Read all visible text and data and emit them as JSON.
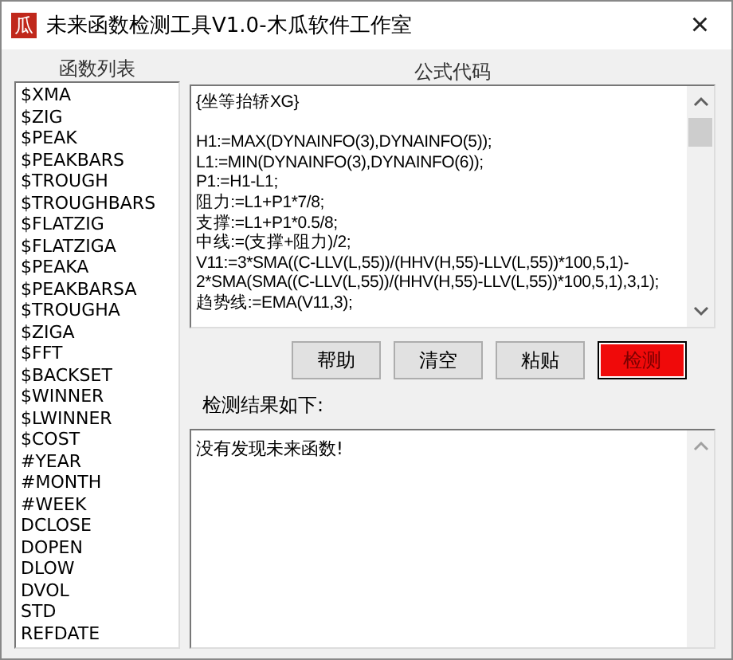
{
  "window": {
    "title": "未来函数检测工具V1.0-木瓜软件工作室",
    "icon_text": "瓜",
    "close": "×"
  },
  "function_list": {
    "header": "函数列表",
    "items": [
      "$XMA",
      "$ZIG",
      "$PEAK",
      "$PEAKBARS",
      "$TROUGH",
      "$TROUGHBARS",
      "$FLATZIG",
      "$FLATZIGA",
      "$PEAKA",
      "$PEAKBARSA",
      "$TROUGHA",
      "$ZIGA",
      "$FFT",
      "$BACKSET",
      "$WINNER",
      "$LWINNER",
      "$COST",
      "#YEAR",
      "#MONTH",
      "#WEEK",
      "DCLOSE",
      "DOPEN",
      "DLOW",
      "DVOL",
      "STD",
      "REFDATE"
    ]
  },
  "formula": {
    "header": "公式代码",
    "lines": [
      "{坐等抬轿XG}",
      "H1:=MAX(DYNAINFO(3),DYNAINFO(5));",
      "L1:=MIN(DYNAINFO(3),DYNAINFO(6));",
      "P1:=H1-L1;",
      "阻力:=L1+P1*7/8;",
      "支撑:=L1+P1*0.5/8;",
      "中线:=(支撑+阻力)/2;",
      "V11:=3*SMA((C-LLV(L,55))/(HHV(H,55)-LLV(L,55))*100,5,1)-",
      "2*SMA(SMA((C-LLV(L,55))/(HHV(H,55)-LLV(L,55))*100,5,1),3,1);",
      "趋势线:=EMA(V11,3);"
    ]
  },
  "buttons": [
    {
      "label": "帮助",
      "highlighted": false
    },
    {
      "label": "清空",
      "highlighted": false
    },
    {
      "label": "粘贴",
      "highlighted": false
    },
    {
      "label": "检测",
      "highlighted": true
    }
  ],
  "result": {
    "label": "检测结果如下:",
    "text": "没有发现未来函数!"
  }
}
